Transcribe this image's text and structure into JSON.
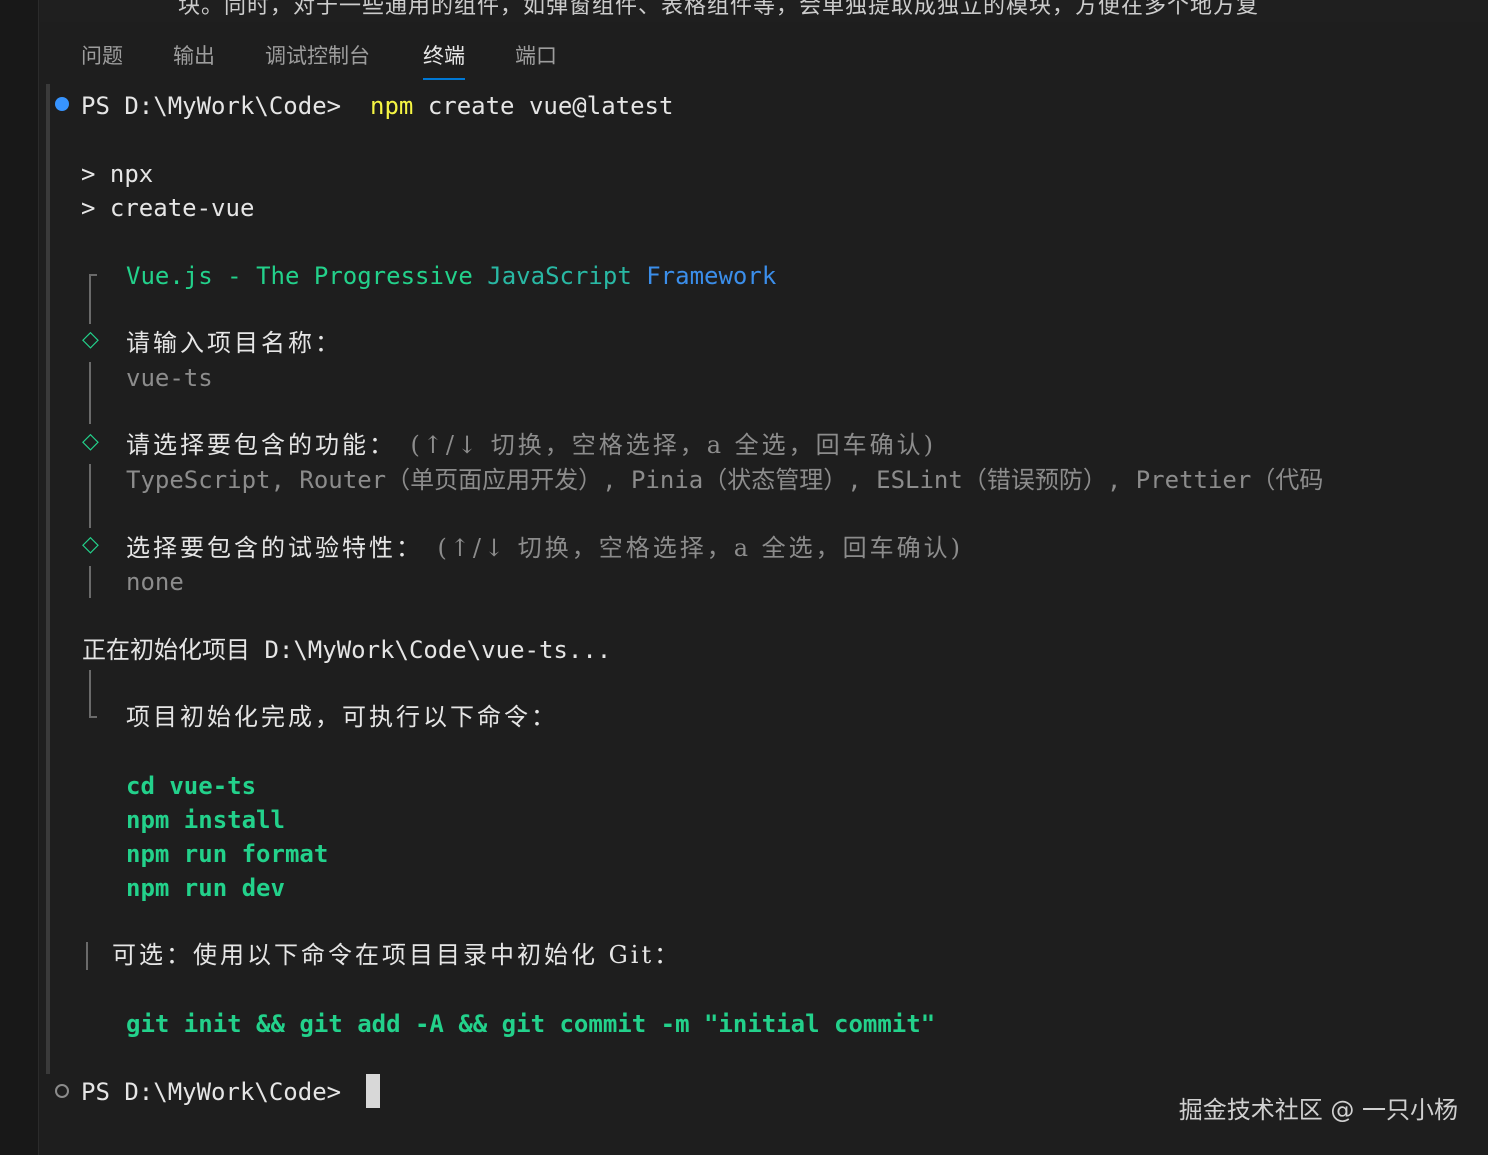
{
  "top_partial_text": "块。同时，对于一些通用的组件，如弹窗组件、表格组件等，会单独提取成独立的模块，方便在多个地方复",
  "panel_tabs": [
    {
      "label": "问题",
      "active": false
    },
    {
      "label": "输出",
      "active": false
    },
    {
      "label": "调试控制台",
      "active": false
    },
    {
      "label": "终端",
      "active": true
    },
    {
      "label": "端口",
      "active": false
    }
  ],
  "terminal": {
    "prompt1": "PS D:\\MyWork\\Code>",
    "cmd_npm": "npm",
    "cmd_rest": "create vue@latest",
    "npx_line": "> npx",
    "create_vue_line": "> create-vue",
    "banner_vue": "Vue.js",
    "banner_dash": "-",
    "banner_the": "The",
    "banner_progressive": "Progressive",
    "banner_js": "JavaScript",
    "banner_framework": "Framework",
    "q1_label": "请输入项目名称：",
    "q1_answer": "vue-ts",
    "q2_label": "请选择要包含的功能：",
    "q2_hint": "(↑/↓ 切换，空格选择，a 全选，回车确认)",
    "q2_answer": "TypeScript, Router（单页面应用开发）, Pinia（状态管理）, ESLint（错误预防）, Prettier（代码",
    "q3_label": "选择要包含的试验特性：",
    "q3_hint": "(↑/↓ 切换，空格选择，a 全选，回车确认)",
    "q3_answer": "none",
    "init_line": "正在初始化项目 D:\\MyWork\\Code\\vue-ts...",
    "done_line": "项目初始化完成，可执行以下命令：",
    "cmds": [
      "cd vue-ts",
      "npm install",
      "npm run format",
      "npm run dev"
    ],
    "optional_line": "可选：使用以下命令在项目目录中初始化 Git：",
    "git_cmd": "git init && git add -A && git commit -m \"initial commit\"",
    "prompt2": "PS D:\\MyWork\\Code>"
  },
  "watermark": "掘金技术社区 @ 一只小杨",
  "colors": {
    "background": "#1e1e1e",
    "green": "#23d18b",
    "yellow": "#f5f543",
    "blue": "#3b8eea",
    "tab_underline": "#0078d4"
  }
}
